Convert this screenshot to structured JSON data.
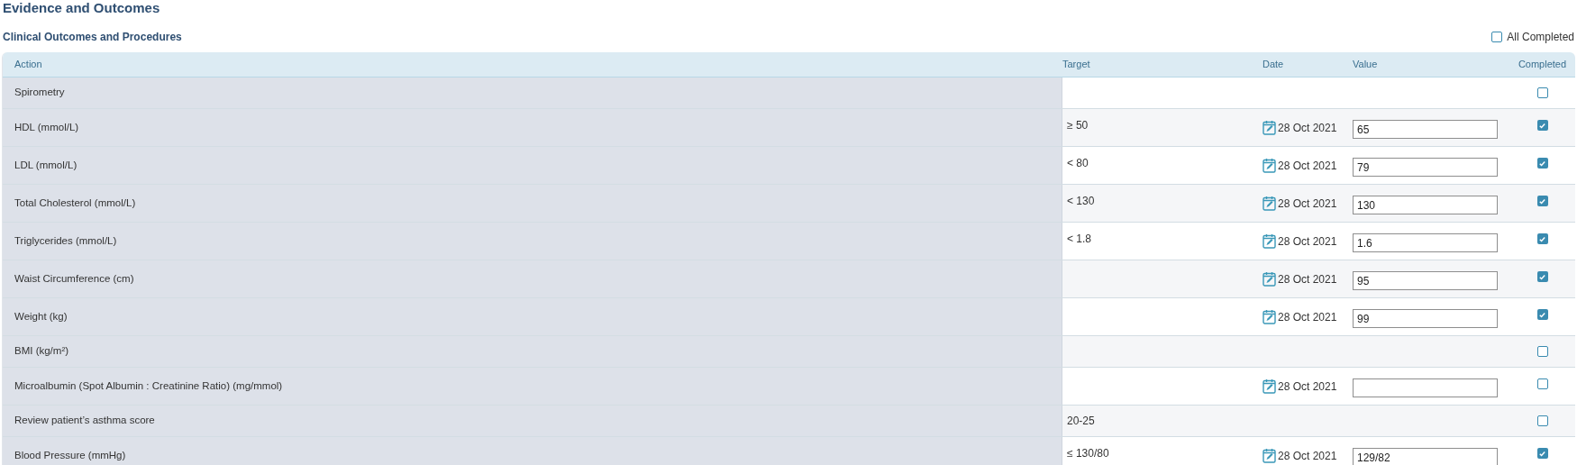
{
  "title": "Evidence and Outcomes",
  "section": {
    "title": "Clinical Outcomes and Procedures",
    "all_completed": {
      "label": "All Completed",
      "checked": false
    }
  },
  "table": {
    "columns": [
      "Action",
      "Target",
      "Date",
      "Value",
      "Completed"
    ],
    "rows": [
      {
        "kind": "check",
        "action": "Spirometry",
        "completed": false
      },
      {
        "kind": "measured",
        "action": "HDL (mmol/L)",
        "target": "≥ 50",
        "date": "28 Oct 2021",
        "value": "65",
        "completed": true
      },
      {
        "kind": "measured",
        "action": "LDL (mmol/L)",
        "target": "< 80",
        "date": "28 Oct 2021",
        "value": "79",
        "completed": true
      },
      {
        "kind": "measured",
        "action": "Total Cholesterol (mmol/L)",
        "target": "< 130",
        "date": "28 Oct 2021",
        "value": "130",
        "completed": true
      },
      {
        "kind": "measured",
        "action": "Triglycerides (mmol/L)",
        "target": "< 1.8",
        "date": "28 Oct 2021",
        "value": "1.6",
        "completed": true
      },
      {
        "kind": "measured",
        "action": "Waist Circumference (cm)",
        "date": "28 Oct 2021",
        "value": "95",
        "completed": true
      },
      {
        "kind": "measured",
        "action": "Weight (kg)",
        "date": "28 Oct 2021",
        "value": "99",
        "completed": true
      },
      {
        "kind": "check",
        "action": "BMI (kg/m²)",
        "completed": false
      },
      {
        "kind": "measured",
        "action": "Microalbumin (Spot Albumin : Creatinine Ratio) (mg/mmol)",
        "date": "28 Oct 2021",
        "completed": false
      },
      {
        "kind": "check",
        "action": "Review patient’s asthma score",
        "target": "20-25",
        "completed": false
      },
      {
        "kind": "measured",
        "action": "Blood Pressure (mmHg)",
        "target": "≤ 130/80",
        "date": "28 Oct 2021",
        "value": "129/82",
        "completed": true
      }
    ]
  }
}
